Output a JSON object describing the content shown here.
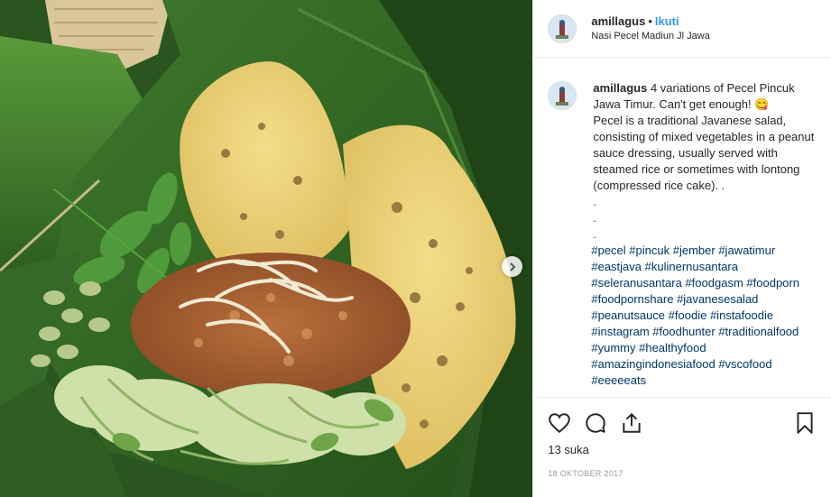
{
  "post": {
    "username": "amillagus",
    "separator": "•",
    "follow_label": "Ikuti",
    "location": "Nasi Pecel Madiun Jl Jawa",
    "caption_user": "amillagus",
    "caption_text": " 4 variations of Pecel Pincuk Jawa Timur. Can't get enough! 😋\nPecel is a traditional Javanese salad, consisting of mixed vegetables in a peanut sauce dressing, usually served with steamed rice or sometimes with lontong (compressed rice cake). .\n.\n.\n.\n",
    "hashtags": [
      "#pecel",
      "#pincuk",
      "#jember",
      "#jawatimur",
      "#eastjava",
      "#kulinernusantara",
      "#seleranusantara",
      "#foodgasm",
      "#foodporn",
      "#foodpornshare",
      "#javanesesalad",
      "#peanutsauce",
      "#foodie",
      "#instafoodie",
      "#instagram",
      "#foodhunter",
      "#traditionalfood",
      "#yummy",
      "#healthyfood",
      "#amazingindonesiafood",
      "#vscofood",
      "#eeeeeats"
    ],
    "likes": "13 suka",
    "date": "18 OKTOBER 2017"
  },
  "icons": {
    "like": "heart-icon",
    "comment": "comment-bubble-icon",
    "share": "share-icon",
    "save": "bookmark-icon",
    "next": "chevron-right-icon"
  },
  "colors": {
    "link": "#3897f0",
    "hashtag": "#003569",
    "text": "#262626",
    "muted": "#999999"
  }
}
